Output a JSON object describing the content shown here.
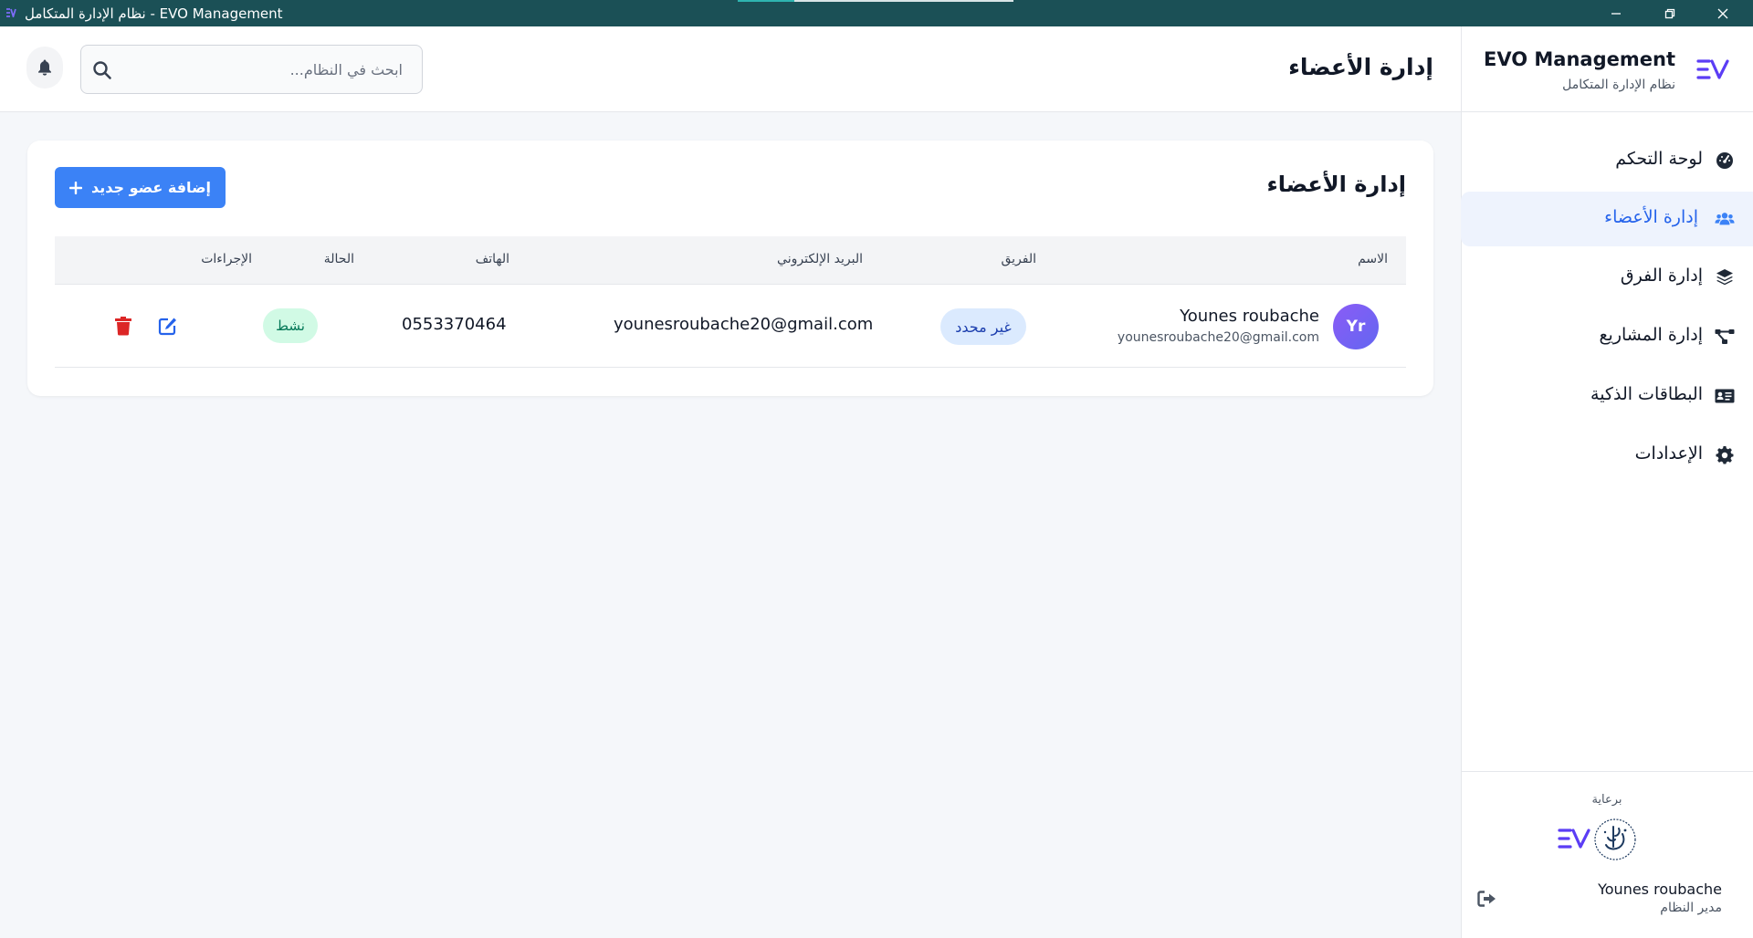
{
  "window": {
    "title": "نظام الإدارة المتكامل - EVO Management",
    "controls": [
      "minimize",
      "restore",
      "close"
    ]
  },
  "brand": {
    "name": "EVO Management",
    "subtitle": "نظام الإدارة المتكامل",
    "logo": "ev-logo-icon",
    "accent_color": "#5b3df5"
  },
  "header": {
    "title": "إدارة الأعضاء",
    "search_placeholder": "ابحث في النظام...",
    "icons": [
      "bell-icon",
      "search-icon"
    ]
  },
  "sidebar": {
    "items": [
      {
        "label": "لوحة التحكم",
        "icon": "dashboard-icon",
        "active": false
      },
      {
        "label": "إدارة الأعضاء",
        "icon": "users-icon",
        "active": true
      },
      {
        "label": "إدارة الفرق",
        "icon": "layers-icon",
        "active": false
      },
      {
        "label": "إدارة المشاريع",
        "icon": "project-diagram-icon",
        "active": false
      },
      {
        "label": "البطاقات الذكية",
        "icon": "id-card-icon",
        "active": false
      },
      {
        "label": "الإعدادات",
        "icon": "gear-icon",
        "active": false
      }
    ],
    "footer": {
      "sponsor_label": "برعاية",
      "user_name": "Younes roubache",
      "user_role": "مدير النظام"
    }
  },
  "members": {
    "title": "إدارة الأعضاء",
    "add_button": "إضافة عضو جديد",
    "columns": [
      "الاسم",
      "الفريق",
      "البريد الإلكتروني",
      "الهاتف",
      "الحالة",
      "الإجراءات"
    ],
    "rows": [
      {
        "initials": "Yr",
        "name": "Younes roubache",
        "email_small": "younesroubache20@gmail.com",
        "team": "غير محدد",
        "email": "younesroubache20@gmail.com",
        "phone": "0553370464",
        "status": "نشط"
      }
    ]
  },
  "colors": {
    "titlebar": "#1b5056",
    "primary": "#3b82f6",
    "active_text": "#2563eb",
    "active_bg": "#eef3fd",
    "status_bg": "#d1fae5",
    "team_bg": "#dbeafe",
    "delete": "#dc2626"
  }
}
